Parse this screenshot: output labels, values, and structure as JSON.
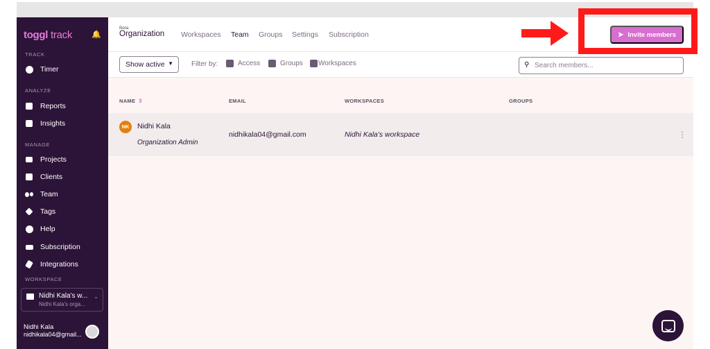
{
  "sidebar": {
    "logo_brand": "toggl",
    "logo_product": "track",
    "sections": {
      "track": "TRACK",
      "analyze": "ANALYZE",
      "manage": "MANAGE",
      "workspace": "WORKSPACE"
    },
    "items": {
      "timer": "Timer",
      "reports": "Reports",
      "insights": "Insights",
      "projects": "Projects",
      "clients": "Clients",
      "team": "Team",
      "tags": "Tags",
      "help": "Help",
      "subscription": "Subscription",
      "integrations": "Integrations"
    },
    "workspace_name": "Nidhi Kala's w...",
    "workspace_sub": "Nidhi Kala's orga...",
    "user_name": "Nidhi Kala",
    "user_email": "nidhikala04@gmail..."
  },
  "header": {
    "beta": "Beta",
    "org": "Organization",
    "tabs": {
      "workspaces": "Workspaces",
      "team": "Team",
      "groups": "Groups",
      "settings": "Settings",
      "subscription": "Subscription"
    },
    "invite": "Invite members"
  },
  "filters": {
    "show_active": "Show active",
    "filter_by": "Filter by:",
    "access": "Access",
    "groups": "Groups",
    "workspaces": "Workspaces",
    "search_placeholder": "Search members..."
  },
  "table": {
    "headers": {
      "name": "NAME",
      "email": "EMAIL",
      "workspaces": "WORKSPACES",
      "groups": "GROUPS"
    },
    "rows": [
      {
        "initials": "NK",
        "name": "Nidhi Kala",
        "role": "Organization Admin",
        "email": "nidhikala04@gmail.com",
        "workspace": "Nidhi Kala's workspace"
      }
    ]
  },
  "colors": {
    "sidebar_bg": "#2c1338",
    "accent": "#d86ed0",
    "highlight_red": "#ff1a1a",
    "avatar_orange": "#e2800f"
  }
}
